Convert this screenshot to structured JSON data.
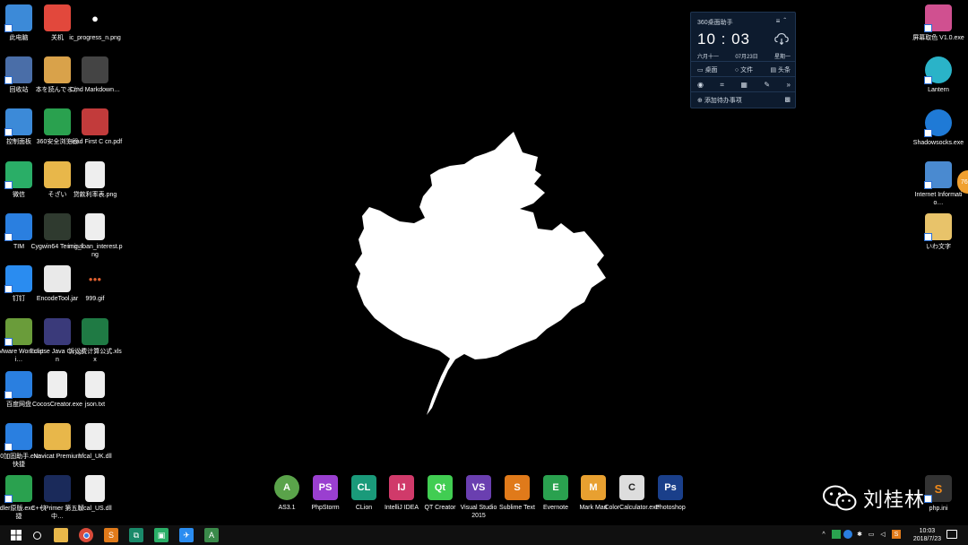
{
  "desktop": {
    "left_icons": [
      {
        "name": "this-pc",
        "label": "此电脑",
        "icon": "computer-icon",
        "color": "#3c8ad8"
      },
      {
        "name": "shutdown",
        "label": "关机",
        "icon": "power-icon",
        "color": "#e2483c"
      },
      {
        "name": "ic-progress",
        "label": "ic_progress_n.png",
        "icon": "dot-icon",
        "color": "#000000"
      },
      {
        "name": "recycle-bin",
        "label": "回收站",
        "icon": "recycle-bin-icon",
        "color": "#4a6ea8"
      },
      {
        "name": "book-jp",
        "label": "本を読んでるか",
        "icon": "book-icon",
        "color": "#d9a24a"
      },
      {
        "name": "cmd-markdown",
        "label": "Cmd Markdown…",
        "icon": "markdown-icon",
        "color": "#444444"
      },
      {
        "name": "control-panel",
        "label": "控制面板",
        "icon": "control-panel-icon",
        "color": "#3c8ad8"
      },
      {
        "name": "browser-360",
        "label": "360安全浏览器",
        "icon": "browser-360-icon",
        "color": "#2aa14f"
      },
      {
        "name": "head-first-c",
        "label": "Head First C cn.pdf",
        "icon": "pdf-icon",
        "color": "#c23b3b"
      },
      {
        "name": "wechat",
        "label": "微信",
        "icon": "wechat-icon",
        "color": "#2aae67"
      },
      {
        "name": "sozai",
        "label": "そざい",
        "icon": "folder-icon",
        "color": "#e8b74a"
      },
      {
        "name": "loan-table",
        "label": "贷款利率表.png",
        "icon": "image-file-icon",
        "color": "#eeeeee"
      },
      {
        "name": "tim",
        "label": "TIM",
        "icon": "tim-icon",
        "color": "#2a7fe0"
      },
      {
        "name": "cygwin",
        "label": "Cygwin64 Terminal",
        "icon": "terminal-icon",
        "color": "#2f3a2f"
      },
      {
        "name": "img-loan",
        "label": "img_loan_interest.png",
        "icon": "image-file-icon",
        "color": "#eeeeee"
      },
      {
        "name": "dingtalk",
        "label": "钉钉",
        "icon": "dingtalk-icon",
        "color": "#2a8cf0"
      },
      {
        "name": "encode-tool",
        "label": "EncodeTool.jar",
        "icon": "java-icon",
        "color": "#e9e9e9"
      },
      {
        "name": "gif-999",
        "label": "999.gif",
        "icon": "dots-icon",
        "color": "#000000"
      },
      {
        "name": "vmware",
        "label": "VMware Workstati…",
        "icon": "vmware-icon",
        "color": "#6a9c3a"
      },
      {
        "name": "eclipse",
        "label": "Eclipse Java Oxygen",
        "icon": "eclipse-icon",
        "color": "#3a3a7a"
      },
      {
        "name": "lawsuit-xlsx",
        "label": "诉讼费计算公式.xlsx",
        "icon": "excel-icon",
        "color": "#1f7a44"
      },
      {
        "name": "baidu-pan",
        "label": "百度网盘",
        "icon": "baidu-pan-icon",
        "color": "#2a7fe0"
      },
      {
        "name": "cocos-creator",
        "label": "CocosCreator.exe",
        "icon": "cocos-icon",
        "color": "#eeeeee"
      },
      {
        "name": "json-txt",
        "label": "json.txt",
        "icon": "text-file-icon",
        "color": "#eeeeee"
      },
      {
        "name": "shield-360",
        "label": "360加固助手.exe - 快捷",
        "icon": "shield-icon",
        "color": "#2a7fe0"
      },
      {
        "name": "navicat",
        "label": "Navicat Premium",
        "icon": "navicat-icon",
        "color": "#e8b74a"
      },
      {
        "name": "hfcal-uk",
        "label": "hfcal_UK.dll",
        "icon": "dll-file-icon",
        "color": "#eeeeee"
      },
      {
        "name": "fiddler",
        "label": "Fiddler原版.exe - 快捷",
        "icon": "fiddler-icon",
        "color": "#2aa14f"
      },
      {
        "name": "cpp-primer",
        "label": "C++ Primer 第五版中…",
        "icon": "book-icon",
        "color": "#1a2a5a"
      },
      {
        "name": "hfcal-us",
        "label": "hfcal_US.dll",
        "icon": "dll-file-icon",
        "color": "#eeeeee"
      }
    ],
    "right_icons": [
      {
        "name": "screen-color",
        "label": "屏幕取色 V1.0.exe",
        "icon": "color-picker-icon",
        "color": "#d05090"
      },
      {
        "name": "lantern",
        "label": "Lantern",
        "icon": "lantern-icon",
        "color": "#2ab3c8"
      },
      {
        "name": "shadowsocks",
        "label": "Shadowsocks.exe",
        "icon": "paper-plane-icon",
        "color": "#1f7ad6"
      },
      {
        "name": "internet-info",
        "label": "Internet Informatio…",
        "icon": "server-icon",
        "color": "#4a8ad0"
      },
      {
        "name": "iwa-text",
        "label": "いわ文字",
        "icon": "folder-icon",
        "color": "#e8c36a"
      }
    ],
    "dock": [
      {
        "name": "as31",
        "label": "AS3.1",
        "icon": "android-studio-icon",
        "glyph": "A",
        "color": "#5aa34a"
      },
      {
        "name": "phpstorm",
        "label": "PhpStorm",
        "icon": "phpstorm-icon",
        "glyph": "PS",
        "color": "#9a3fd0"
      },
      {
        "name": "clion",
        "label": "CLion",
        "icon": "clion-icon",
        "glyph": "CL",
        "color": "#1a9a7a"
      },
      {
        "name": "intellij",
        "label": "IntelliJ IDEA",
        "icon": "intellij-icon",
        "glyph": "IJ",
        "color": "#d03a6a"
      },
      {
        "name": "qt-creator",
        "label": "QT Creator",
        "icon": "qt-icon",
        "glyph": "Qt",
        "color": "#41cd52"
      },
      {
        "name": "visual-studio",
        "label": "Visual Studio 2015",
        "icon": "visual-studio-icon",
        "glyph": "VS",
        "color": "#6a3fb0"
      },
      {
        "name": "sublime",
        "label": "Sublime Text",
        "icon": "sublime-icon",
        "glyph": "S",
        "color": "#e07a1a"
      },
      {
        "name": "evernote",
        "label": "Evernote",
        "icon": "evernote-icon",
        "glyph": "E",
        "color": "#2aa14f"
      },
      {
        "name": "markman",
        "label": "Mark Man",
        "icon": "markman-icon",
        "glyph": "M",
        "color": "#e8a030"
      },
      {
        "name": "color-calc",
        "label": "ColorCalculator.exe",
        "icon": "color-calculator-icon",
        "glyph": "C",
        "color": "#dddddd"
      },
      {
        "name": "photoshop",
        "label": "Photoshop",
        "icon": "photoshop-icon",
        "glyph": "Ps",
        "color": "#1a3f8a"
      }
    ],
    "phpini": {
      "label": "php.ini",
      "icon": "sublime-icon"
    }
  },
  "widget": {
    "title": "360桌面助手",
    "time": "10 : 03",
    "lunar": "六月十一",
    "date": "07月23日",
    "weekday": "星期一",
    "tabs": [
      "桌面",
      "文件",
      "头条"
    ],
    "add_todo": "添加待办事项"
  },
  "watermark": {
    "text": "刘桂林"
  },
  "taskbar": {
    "clock_time": "10:03",
    "clock_date": "2018/7/23"
  },
  "side_tab": {
    "text": "76"
  }
}
